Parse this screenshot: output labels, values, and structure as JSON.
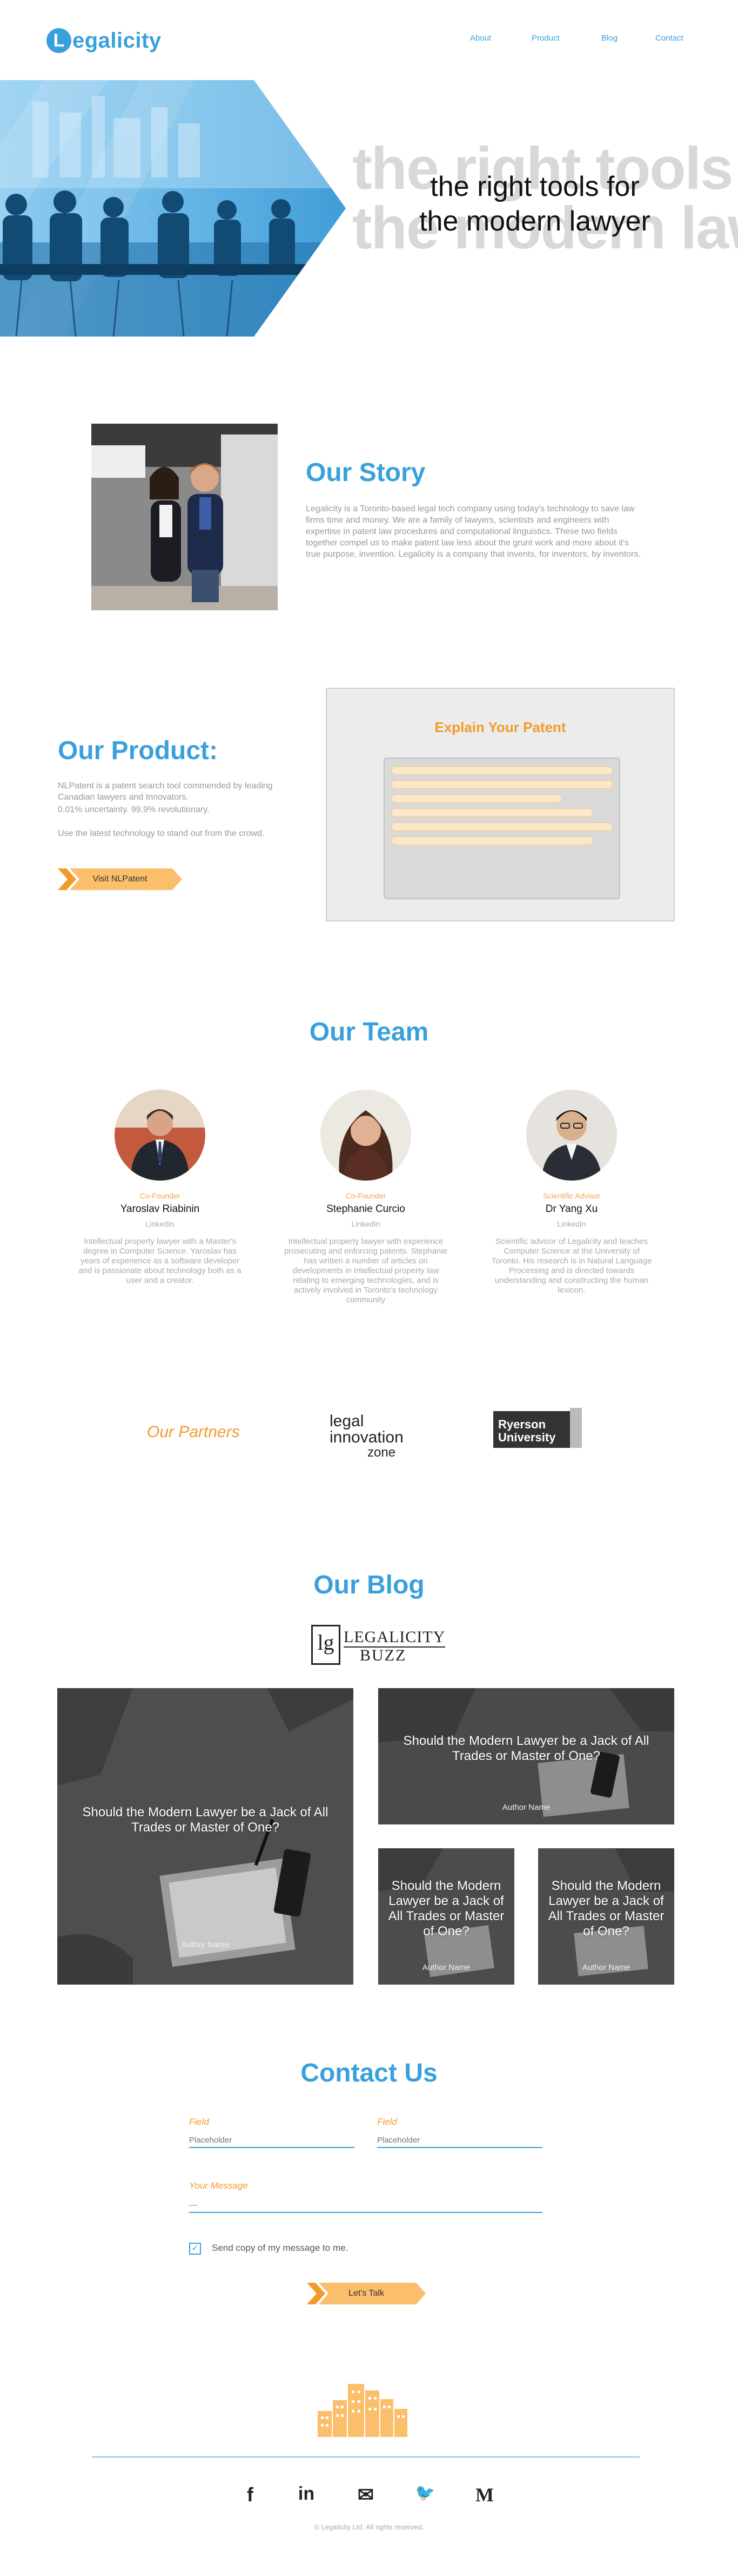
{
  "header": {
    "logo_letter": "L",
    "logo_text": "egalicity",
    "nav": [
      "About",
      "Product",
      "Blog",
      "Contact"
    ]
  },
  "hero": {
    "line1": "the right tools for",
    "line2": "the modern lawyer",
    "ghost1": "the right tools f",
    "ghost2": "the modern law"
  },
  "story": {
    "title": "Our Story",
    "text": "Legalicity is a Toronto-based legal tech company using today's technology to save law firms time and money. We are a family of lawyers, scientists and engineers with expertise in patent law procedures and computational linguistics. These two fields together compel us to make patent law less about the grunt work and more about it's true purpose, invention. Legalicity is a company that invents, for inventors, by inventors."
  },
  "product": {
    "title": "Our Product:",
    "line1": "NLPatent is a patent search tool commended by leading Canadian lawyers and Innovators.",
    "line2": "0.01% uncertainty. 99.9% revolutionary.",
    "line3": "Use the latest technology to stand out from the crowd.",
    "button": "Visit NLPatent",
    "demo_title": "Explain Your Patent"
  },
  "team": {
    "title": "Our Team",
    "members": [
      {
        "role": "Co-Founder",
        "name": "Yaroslav Riabinin",
        "link": "LinkedIn",
        "bio": "Intellectual property lawyer with a Master's degree in Computer Science. Yaroslav has years of experience as a software developer and is passionate about technology both as a user and a creator."
      },
      {
        "role": "Co-Founder",
        "name": "Stephanie Curcio",
        "link": "LinkedIn",
        "bio": "Intellectual property lawyer with experience prosecuting and enforcing patents. Stephanie has written a number of articles on developments in Intellectual property law relating to emerging technologies, and is actively involved in Toronto's technology community"
      },
      {
        "role": "Scientific Advisor",
        "name": "Dr Yang Xu",
        "link": "LinkedIn",
        "bio": "Scientific advisor of Legalicity and teaches Computer Science at the University of Toronto. His research is in Natural Language Processing and is directed towards understanding and constructing the human lexicon."
      }
    ]
  },
  "partners": {
    "label": "Our Partners",
    "lic": [
      "legal",
      "innovation",
      "zone"
    ],
    "ryerson": [
      "Ryerson",
      "University"
    ]
  },
  "blog": {
    "title": "Our Blog",
    "buzz_letters": "lg",
    "buzz_line1": "LEGALICITY",
    "buzz_line2": "BUZZ",
    "posts": [
      {
        "title": "Should the Modern Lawyer be a Jack of All Trades or Master of One?",
        "author": "Author Name"
      },
      {
        "title": "Should the Modern Lawyer be a Jack of All Trades or Master of One?",
        "author": "Author Name"
      },
      {
        "title": "Should the Modern Lawyer be a Jack of All Trades or Master of One?",
        "author": "Author Name"
      },
      {
        "title": "Should the Modern Lawyer be a Jack of All Trades or Master of One?",
        "author": "Author Name"
      }
    ]
  },
  "contact": {
    "title": "Contact Us",
    "field1_label": "Field",
    "field1_placeholder": "Placeholder",
    "field2_label": "Field",
    "field2_placeholder": "Placeholder",
    "message_label": "Your Message",
    "message_value": "—",
    "checkbox_label": "Send copy of my message to me.",
    "button": "Let's Talk"
  },
  "footer": {
    "social": [
      "f",
      "in",
      "✉",
      "🐦",
      "M"
    ],
    "copyright": "© Legalicity Ltd. All rights reserved."
  },
  "colors": {
    "brand_blue": "#3aa0db",
    "accent_orange": "#f39a2a"
  }
}
